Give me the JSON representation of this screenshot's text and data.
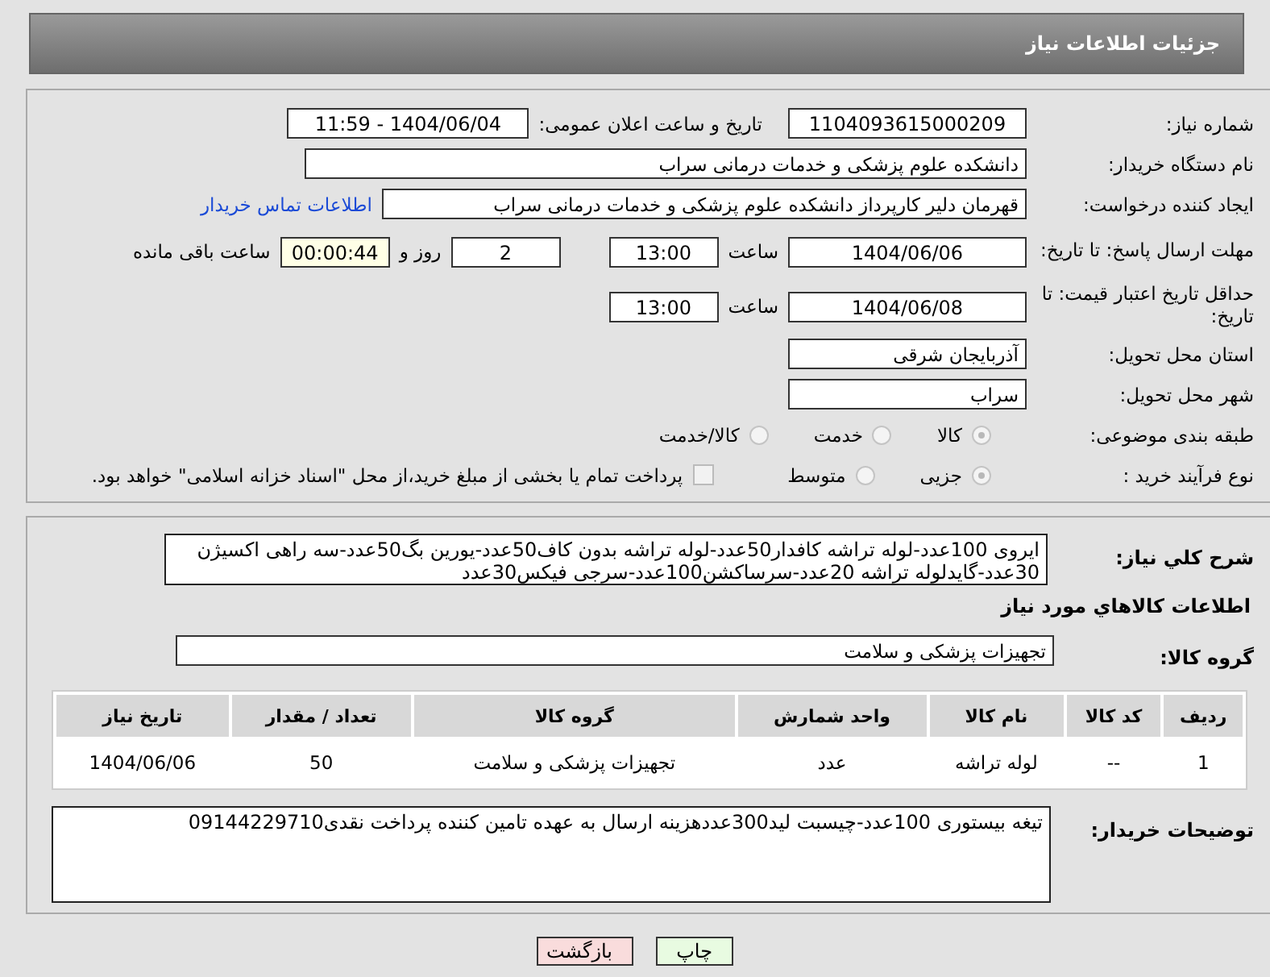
{
  "header": {
    "title": "جزئیات اطلاعات نیاز"
  },
  "fields": {
    "need_number": {
      "label": "شماره نیاز:",
      "value": "1104093615000209"
    },
    "announce": {
      "label": "تاریخ و ساعت اعلان عمومی:",
      "value": "1404/06/04 - 11:59"
    },
    "buyer": {
      "label": "نام دستگاه خریدار:",
      "value": "دانشکده علوم پزشکی و خدمات درمانی سراب"
    },
    "creator": {
      "label": "ایجاد کننده درخواست:",
      "value": "قهرمان دلیر کارپرداز دانشکده علوم پزشکی و خدمات درمانی سراب",
      "link": "اطلاعات تماس خریدار"
    },
    "deadline": {
      "label": "مهلت ارسال پاسخ: تا تاریخ:",
      "date": "1404/06/06",
      "time_label": "ساعت",
      "time": "13:00",
      "days": "2",
      "days_label": "روز و",
      "remaining": "00:00:44",
      "remaining_label": "ساعت باقی مانده"
    },
    "validity": {
      "label": "حداقل تاریخ اعتبار قیمت: تا تاریخ:",
      "date": "1404/06/08",
      "time_label": "ساعت",
      "time": "13:00"
    },
    "province": {
      "label": "استان محل تحویل:",
      "value": "آذربایجان شرقی"
    },
    "city": {
      "label": "شهر محل تحویل:",
      "value": "سراب"
    }
  },
  "category": {
    "label": "طبقه بندی موضوعی:",
    "options": [
      {
        "label": "کالا",
        "selected": true
      },
      {
        "label": "خدمت",
        "selected": false
      },
      {
        "label": "کالا/خدمت",
        "selected": false
      }
    ]
  },
  "process": {
    "label": "نوع فرآیند خرید :",
    "options": [
      {
        "label": "جزیی",
        "selected": true
      },
      {
        "label": "متوسط",
        "selected": false
      }
    ],
    "payment": {
      "label": "پرداخت تمام یا بخشی از مبلغ خرید،از محل \"اسناد خزانه اسلامی\" خواهد بود.",
      "checked": false
    }
  },
  "description": {
    "label": "شرح کلي نياز:",
    "value": "ایروی 100عدد-لوله تراشه کافدار50عدد-لوله تراشه بدون کاف50عدد-یورین بگ50عدد-سه راهی اکسیژن 30عدد-گایدلوله تراشه 20عدد-سرساکشن100عدد-سرجی فیکس30عدد"
  },
  "goods_heading": "اطلاعات کالاهاي مورد نياز",
  "goods_group": {
    "label": "گروه کالا:",
    "value": "تجهیزات پزشکی و سلامت"
  },
  "table": {
    "columns": [
      "ردیف",
      "کد کالا",
      "نام کالا",
      "واحد شمارش",
      "گروه کالا",
      "تعداد / مقدار",
      "تاریخ نیاز"
    ],
    "rows": [
      [
        "1",
        "--",
        "لوله تراشه",
        "عدد",
        "تجهیزات پزشکی و سلامت",
        "50",
        "1404/06/06"
      ]
    ]
  },
  "buyer_notes": {
    "label": "توضیحات خریدار:",
    "value": "تیغه بیستوری 100عدد-چیسبت لید300عددهزینه ارسال به عهده تامین کننده پرداخت نقدی09144229710"
  },
  "buttons": [
    {
      "label": "چاپ",
      "kind": "print"
    },
    {
      "label": "بازگشت",
      "kind": "back"
    }
  ]
}
